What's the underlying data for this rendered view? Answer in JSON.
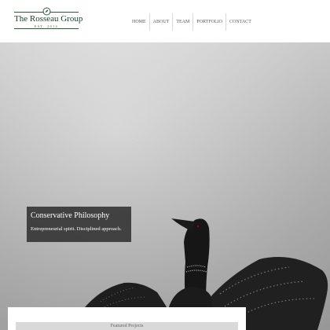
{
  "brand": {
    "name": "The Rosseau Group",
    "established": "EST. 2014",
    "emblem_icon": "leaf-crest-icon",
    "color": "#2d5a3d"
  },
  "nav": {
    "items": [
      {
        "label": "HOME"
      },
      {
        "label": "ABOUT"
      },
      {
        "label": "TEAM"
      },
      {
        "label": "PORTFOLIO"
      },
      {
        "label": "CONTACT"
      }
    ]
  },
  "hero": {
    "image": "loon-spreading-wings-on-water",
    "caption_title": "Conservative Philosophy",
    "caption_subtitle": "Entrepreneurial spirit. Disciplined approach."
  },
  "featured": {
    "label": "Featured Projects"
  }
}
